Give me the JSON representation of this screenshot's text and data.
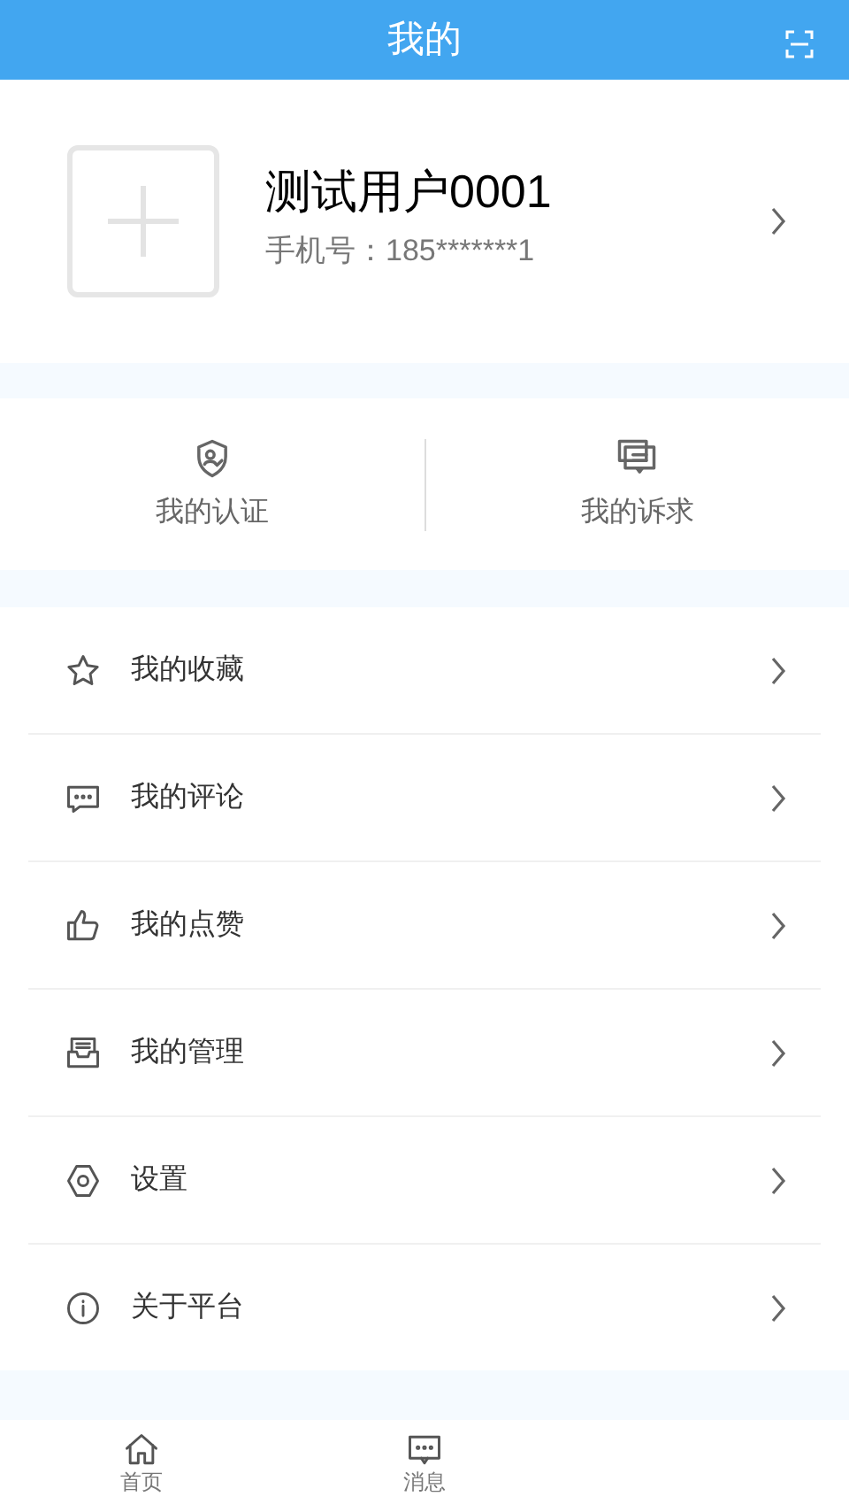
{
  "header": {
    "title": "我的"
  },
  "profile": {
    "name": "测试用户0001",
    "phone": "手机号：185*******1"
  },
  "shortcuts": [
    {
      "kind": "certify",
      "label": "我的认证"
    },
    {
      "kind": "appeal",
      "label": "我的诉求"
    }
  ],
  "menu": [
    {
      "kind": "star",
      "label": "我的收藏"
    },
    {
      "kind": "comment",
      "label": "我的评论"
    },
    {
      "kind": "like",
      "label": "我的点赞"
    },
    {
      "kind": "manage",
      "label": "我的管理"
    },
    {
      "kind": "settings",
      "label": "设置"
    },
    {
      "kind": "info",
      "label": "关于平台"
    }
  ],
  "tab_bar": [
    {
      "kind": "home",
      "label": "首页",
      "selected": false
    },
    {
      "kind": "message",
      "label": "消息",
      "selected": false
    }
  ]
}
